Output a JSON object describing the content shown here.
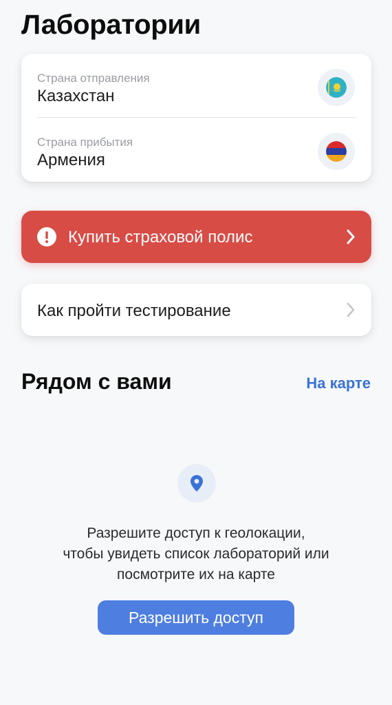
{
  "header": {
    "title": "Лаборатории"
  },
  "route": {
    "departure": {
      "caption": "Страна отправления",
      "country": "Казахстан",
      "flag_icon": "kazakhstan-flag-icon"
    },
    "arrival": {
      "caption": "Страна прибытия",
      "country": "Армения",
      "flag_icon": "armenia-flag-icon"
    }
  },
  "insurance": {
    "label": "Купить страховой полис",
    "icon": "alert-icon",
    "color": "#d84c46"
  },
  "testing": {
    "label": "Как пройти тестирование"
  },
  "nearby": {
    "title": "Рядом с вами",
    "map_link": "На карте",
    "geo_icon": "location-pin-icon",
    "message_lines": [
      "Разрешите доступ к геолокации,",
      "чтобы увидеть список лабораторий или",
      "посмотрите их на карте"
    ],
    "button_label": "Разрешить доступ"
  },
  "colors": {
    "accent": "#4e7ee0",
    "link": "#3a73d8",
    "danger": "#d84c46"
  }
}
